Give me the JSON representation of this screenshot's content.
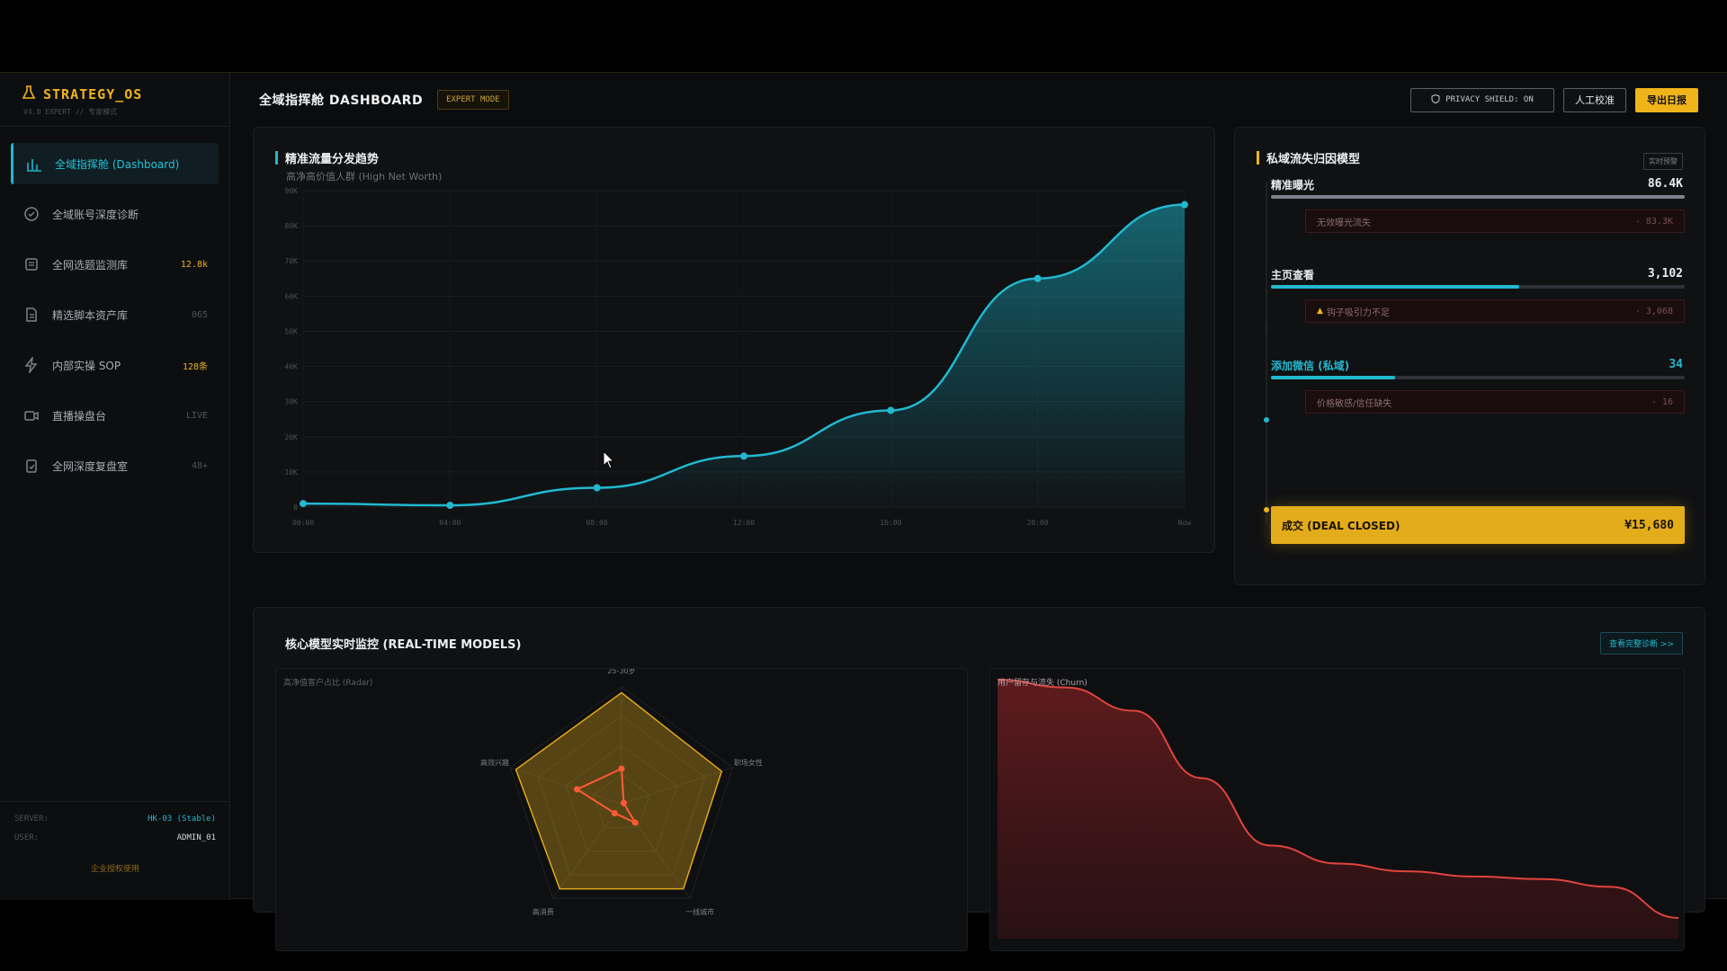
{
  "brand": {
    "title": "STRATEGY_OS",
    "subtitle": "V4.0 EXPERT // 专家模式"
  },
  "sidebar": {
    "items": [
      {
        "label": "全域指挥舱 (Dashboard)",
        "badge": "",
        "icon": "chart-icon",
        "active": true
      },
      {
        "label": "全域账号深度诊断",
        "badge": "",
        "icon": "target-icon"
      },
      {
        "label": "全网选题监测库",
        "badge": "12.8k",
        "icon": "database-icon",
        "hot": true
      },
      {
        "label": "精选脚本资产库",
        "badge": "865",
        "icon": "document-icon"
      },
      {
        "label": "内部实操 SOP",
        "badge": "128条",
        "icon": "bolt-icon",
        "hot": true
      },
      {
        "label": "直播操盘台",
        "badge": "LIVE",
        "icon": "video-icon"
      },
      {
        "label": "全网深度复盘室",
        "badge": "48+",
        "icon": "clipboard-icon"
      }
    ],
    "footer": {
      "server_key": "SERVER:",
      "server_value": "HK-03 (Stable)",
      "user_key": "USER:",
      "user_value": "ADMIN_01",
      "note": "企业授权使用"
    }
  },
  "header": {
    "title": "全域指挥舱 DASHBOARD",
    "mode": "EXPERT MODE",
    "privacy": "PRIVACY SHIELD: ON",
    "manual": "人工校准",
    "export": "导出日报"
  },
  "traffic": {
    "title": "精准流量分发趋势",
    "subtitle": "高净高价值人群 (High Net Worth)",
    "accent": "#22b8cf",
    "chart_data": {
      "type": "area",
      "x": [
        "00:00",
        "04:00",
        "08:00",
        "12:00",
        "16:00",
        "20:00",
        "Now"
      ],
      "y": [
        1000,
        500,
        5500,
        14500,
        27500,
        65000,
        86000
      ],
      "ylim": [
        0,
        90000
      ],
      "yticks": [
        "0",
        "10K",
        "20K",
        "30K",
        "40K",
        "50K",
        "60K",
        "70K",
        "80K",
        "90K"
      ],
      "grid": true
    }
  },
  "funnel": {
    "title": "私域流失归因模型",
    "tag": "实时预警",
    "stages": [
      {
        "label": "精准曝光",
        "value": "86.4K",
        "fill": 1.0,
        "loss_label": "无效曝光流失",
        "loss_value": "- 83.3K"
      },
      {
        "label": "主页查看",
        "value": "3,102",
        "fill": 0.6,
        "loss_label": "钩子吸引力不足",
        "loss_value": "- 3,068"
      },
      {
        "label": "添加微信 (私域)",
        "value": "34",
        "fill": 0.3,
        "loss_label": "价格敏感/信任缺失",
        "loss_value": "- 16"
      }
    ],
    "deal": {
      "label": "成交 (DEAL CLOSED)",
      "value": "¥15,680"
    }
  },
  "models": {
    "title": "核心模型实时监控 (REAL-TIME MODELS)",
    "link": "查看完整诊断 >>",
    "radar": {
      "title": "高净值客户占比 (Radar)",
      "chart_data": {
        "type": "radar",
        "axes": [
          "25-30岁",
          "职场女性",
          "一线城市",
          "高消费",
          "高效兴趣"
        ],
        "series": [
          {
            "values": [
              0.95,
              0.9,
              0.9,
              0.9,
              0.95
            ],
            "color": "#e0a81b"
          },
          {
            "values": [
              0.3,
              0.02,
              0.2,
              0.1,
              0.4
            ],
            "color": "#ff5a36"
          }
        ]
      }
    },
    "churn": {
      "title": "用户留存与流失 (Churn)",
      "chart_data": {
        "type": "area",
        "x": [
          0,
          1,
          2,
          3,
          4,
          5,
          6,
          7,
          8,
          9,
          10
        ],
        "y": [
          100,
          97,
          88,
          62,
          36,
          29,
          26,
          24,
          23,
          20,
          8
        ],
        "ylim": [
          0,
          100
        ]
      }
    }
  }
}
